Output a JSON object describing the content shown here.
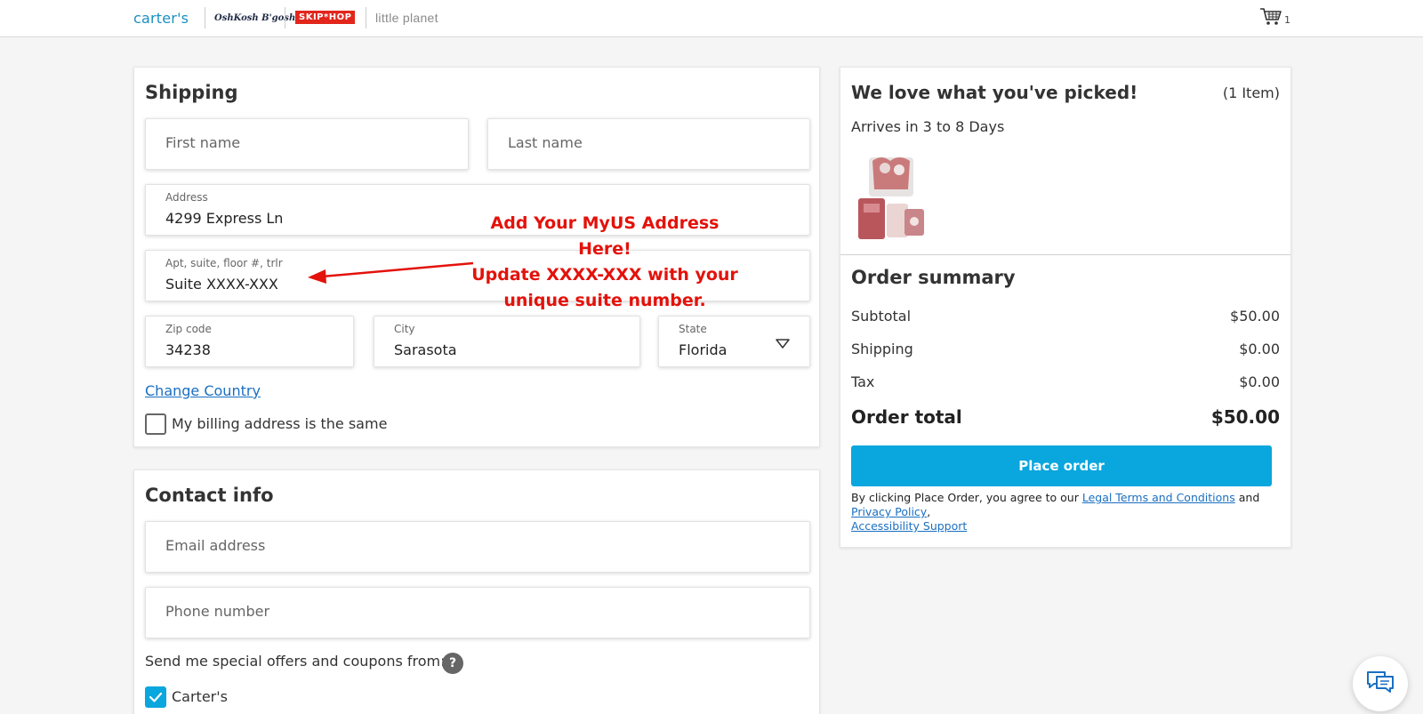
{
  "header": {
    "brands": [
      "carter's",
      "OshKosh B'gosh",
      "SKIP*HOP",
      "little planet"
    ],
    "cart_count": "1"
  },
  "shipping": {
    "title": "Shipping",
    "first_name_placeholder": "First name",
    "last_name_placeholder": "Last name",
    "address_label": "Address",
    "address_value": "4299 Express Ln",
    "apt_label": "Apt, suite, floor #, trlr",
    "apt_value": "Suite XXXX-XXX",
    "zip_label": "Zip code",
    "zip_value": "34238",
    "city_label": "City",
    "city_value": "Sarasota",
    "state_label": "State",
    "state_value": "Florida",
    "change_country": "Change Country",
    "billing_same": "My billing address is the same"
  },
  "annotation": {
    "line1": "Add Your MyUS Address Here!",
    "line2": "Update XXXX-XXX with your",
    "line3": "unique suite number.",
    "color": "#e3120b"
  },
  "contact": {
    "title": "Contact info",
    "email_placeholder": "Email address",
    "phone_placeholder": "Phone number",
    "offers_text": "Send me special offers and coupons from:",
    "offers_help": "?",
    "carters_option": "Carter's"
  },
  "summary": {
    "heading": "We love what you've picked!",
    "item_count": "(1 Item)",
    "arrival": "Arrives in 3 to 8 Days",
    "order_summary_title": "Order summary",
    "subtotal_label": "Subtotal",
    "subtotal_value": "$50.00",
    "shipping_label": "Shipping",
    "shipping_value": "$0.00",
    "tax_label": "Tax",
    "tax_value": "$0.00",
    "total_label": "Order total",
    "total_value": "$50.00",
    "place_order": "Place order",
    "legal_prefix": "By clicking Place Order, you agree to our",
    "legal_terms": "Legal Terms and Conditions",
    "legal_and": "and",
    "privacy_policy": "Privacy Policy",
    "accessibility": "Accessibility Support"
  },
  "colors": {
    "accent": "#0aa6de",
    "link": "#1a6fc1",
    "brand_carters": "#1a8fc1",
    "skiphop": "#e2261c"
  }
}
